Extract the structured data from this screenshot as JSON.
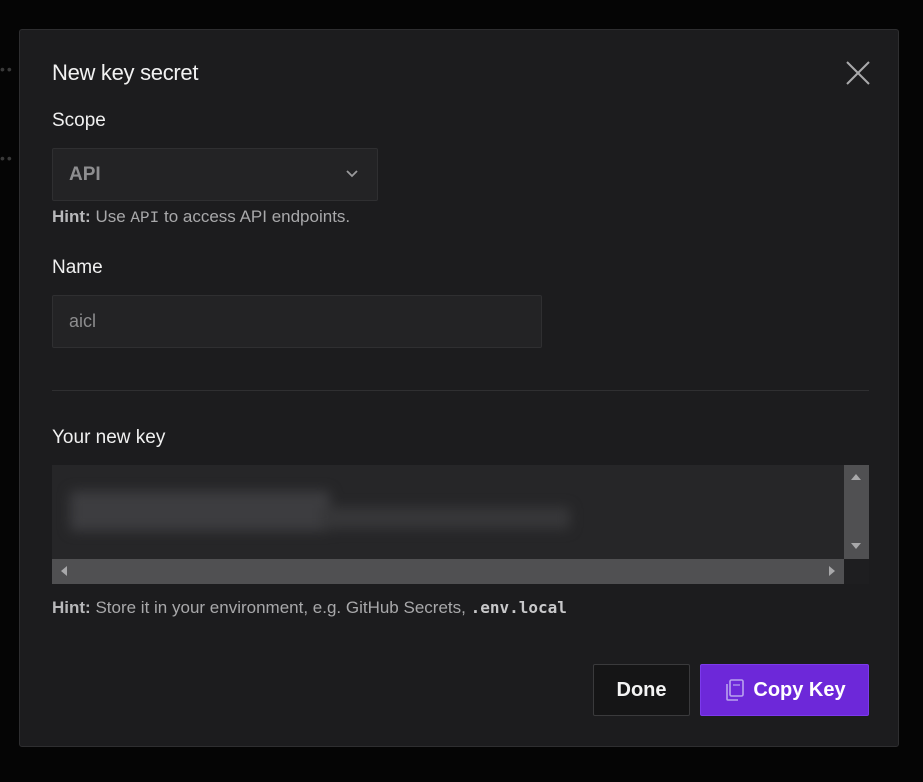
{
  "dialog": {
    "title": "New key secret",
    "close_icon": "close-icon"
  },
  "scope": {
    "label": "Scope",
    "selected": "API",
    "chevron_icon": "chevron-down-icon",
    "hint_prefix": "Hint:",
    "hint_text_1": "Use",
    "hint_code": "API",
    "hint_text_2": "to access API endpoints."
  },
  "name": {
    "label": "Name",
    "value": "aicl"
  },
  "key": {
    "label": "Your new key",
    "value_obscured": true,
    "hint_prefix": "Hint:",
    "hint_text": "Store it in your environment, e.g. GitHub Secrets,",
    "hint_code": ".env.local"
  },
  "actions": {
    "done_label": "Done",
    "copy_label": "Copy Key",
    "copy_icon": "copy-icon"
  },
  "colors": {
    "modal_bg": "#1c1c1e",
    "accent": "#6d28d9",
    "backdrop": "#050505"
  }
}
